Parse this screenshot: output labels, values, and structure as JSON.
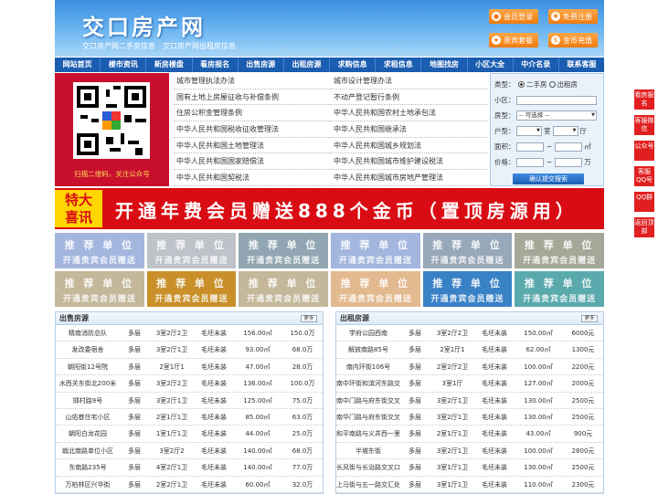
{
  "header": {
    "logo": "交口房产网",
    "slogan": "交口房产网二手房信息　交口房产网出租房信息",
    "buttons": [
      {
        "label": "会员登录",
        "icon": "user-icon"
      },
      {
        "label": "免费注册",
        "icon": "register-icon"
      },
      {
        "label": "贵宾套餐",
        "icon": "vip-icon"
      },
      {
        "label": "金币充值",
        "icon": "coin-icon"
      }
    ]
  },
  "nav": [
    "网站首页",
    "楼市资讯",
    "新房楼盘",
    "看房报名",
    "出售房源",
    "出租房源",
    "求购信息",
    "求租信息",
    "地图找房",
    "小区大全",
    "中介名录",
    "联系客服"
  ],
  "qr": {
    "caption": "扫描二维码，关注公众号"
  },
  "links": [
    "城市管理执法办法",
    "城市设计管理办法",
    "国有土地上房屋征收与补偿条例",
    "不动产登记暂行条例",
    "住房公积金管理条例",
    "中华人民共和国农村土地承包法",
    "中华人民共和国税收征收管理法",
    "中华人民共和国继承法",
    "中华人民共和国土地管理法",
    "中华人民共和国城乡规划法",
    "中华人民共和国国家赔偿法",
    "中华人民共和国城市维护建设税法",
    "中华人民共和国契税法",
    "中华人民共和国城市房地产管理法"
  ],
  "search": {
    "type_label": "类型：",
    "opt1": "二手房",
    "opt2": "出租房",
    "area_label": "小区：",
    "kind_label": "房型：",
    "kind_value": "-- 可选择 --",
    "layout_label": "户型：",
    "room": "室",
    "hall": "厅",
    "size_label": "面积：",
    "unit_m2": "㎡",
    "tilde": "~",
    "price_label": "价格：",
    "unit_wan": "万",
    "button": "确认提交搜索"
  },
  "banner": {
    "badge1": "特大",
    "badge2": "喜讯",
    "text": "开通年费会员赠送888个金币（置顶房源用）"
  },
  "ads": {
    "line1": "推 荐 单 位",
    "line2": "开通贵宾会员赠送",
    "colors": [
      "#a3b6de",
      "#bec2c9",
      "#91a6b2",
      "#a3b6de",
      "#97a8b9",
      "#a5a898",
      "#c4b79a",
      "#c9902a",
      "#c4b79a",
      "#e3b990",
      "#3a82c6",
      "#5aa9ad"
    ]
  },
  "sale": {
    "title": "出售房源",
    "more": "更多",
    "rows": [
      [
        "精南消防总队",
        "多层",
        "3室2厅2卫",
        "毛坯未装",
        "156.00㎡",
        "150.0万"
      ],
      [
        "发改委宿舍",
        "多层",
        "3室2厅1卫",
        "毛坯未装",
        "93.00㎡",
        "68.0万"
      ],
      [
        "朝阳街12号院",
        "多层",
        "2室1厅1",
        "毛坯未装",
        "47.00㎡",
        "28.0万"
      ],
      [
        "水西关东街北200米",
        "多层",
        "3室2厅2卫",
        "毛坯未装",
        "136.00㎡",
        "100.0万"
      ],
      [
        "邯村路9号",
        "多层",
        "3室2厅1卫",
        "毛坯未装",
        "125.00㎡",
        "75.0万"
      ],
      [
        "山佑巷住宅小区",
        "多层",
        "2室1厅1卫",
        "毛坯未装",
        "85.00㎡",
        "63.0万"
      ],
      [
        "朝阳白龙花园",
        "多层",
        "1室1厅1卫",
        "毛坯未装",
        "44.00㎡",
        "25.0万"
      ],
      [
        "戟北南路单位小区",
        "多层",
        "3室2厅2",
        "毛坯未装",
        "140.00㎡",
        "68.0万"
      ],
      [
        "东南路235号",
        "多层",
        "4室2厅1卫",
        "毛坯未装",
        "140.00㎡",
        "77.0万"
      ],
      [
        "万柏林区兴华街",
        "多层",
        "2室2厅1卫",
        "毛坯未装",
        "60.00㎡",
        "32.0万"
      ]
    ]
  },
  "rent": {
    "title": "出租房源",
    "more": "更多",
    "rows": [
      [
        "学府公园西南",
        "多层",
        "3室2厅2卫",
        "毛坯未装",
        "150.00㎡",
        "6000元"
      ],
      [
        "解放南路85号",
        "多层",
        "2室1厅1",
        "毛坯未装",
        "62.00㎡",
        "1300元"
      ],
      [
        "南内环街106号",
        "多层",
        "2室2厅2卫",
        "毛坯未装",
        "100.00㎡",
        "2200元"
      ],
      [
        "南中环街和滨河东路交",
        "多层",
        "3室1厅",
        "毛坯未装",
        "127.00㎡",
        "2000元"
      ],
      [
        "南中门路与府东街交叉",
        "多层",
        "3室2厅1卫",
        "毛坯未装",
        "130.00㎡",
        "2500元"
      ],
      [
        "南华门路与府东街交叉",
        "多层",
        "3室2厅1卫",
        "毛坯未装",
        "130.00㎡",
        "2500元"
      ],
      [
        "和平南路与义井西一里",
        "多层",
        "2室1厅1卫",
        "毛坯未装",
        "43.00㎡",
        "900元"
      ],
      [
        "半坡东街",
        "多层",
        "3室2厅1卫",
        "毛坯未装",
        "100.00㎡",
        "2800元"
      ],
      [
        "长风街与长治路交叉口",
        "多层",
        "3室1厅1卫",
        "毛坯未装",
        "130.00㎡",
        "2500元"
      ],
      [
        "上马街与五一路交汇处",
        "多层",
        "3室1厅1卫",
        "毛坯未装",
        "110.00㎡",
        "2300元"
      ]
    ]
  },
  "side": [
    "看房报名",
    "客服微信",
    "公众号",
    "客服QQ号",
    "QQ群",
    "返回顶部"
  ]
}
